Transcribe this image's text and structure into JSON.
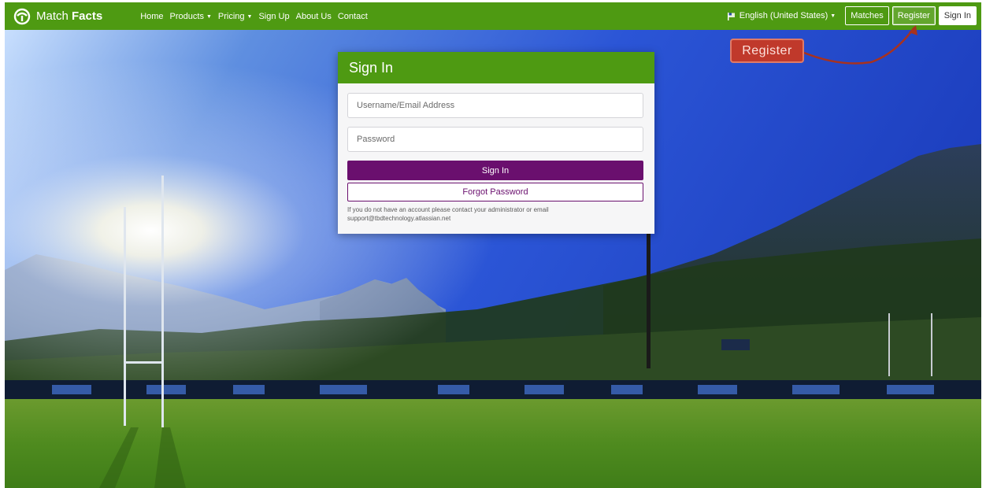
{
  "brand": {
    "name_light": "Match ",
    "name_bold": "Facts",
    "icon": "matchfacts-logo-icon"
  },
  "nav": {
    "links": [
      {
        "label": "Home",
        "dropdown": false
      },
      {
        "label": "Products",
        "dropdown": true
      },
      {
        "label": "Pricing",
        "dropdown": true
      },
      {
        "label": "Sign Up",
        "dropdown": false
      },
      {
        "label": "About Us",
        "dropdown": false
      },
      {
        "label": "Contact",
        "dropdown": false
      }
    ],
    "language": {
      "label": "English (United States)",
      "icon": "flag-icon"
    },
    "matches_label": "Matches",
    "register_label": "Register",
    "signin_label": "Sign In"
  },
  "annotation": {
    "callout_text": "Register",
    "color": "#c0392b"
  },
  "login": {
    "title": "Sign In",
    "username_placeholder": "Username/Email Address",
    "password_placeholder": "Password",
    "submit_label": "Sign In",
    "forgot_label": "Forgot Password",
    "help_text": "If you do not have an account please contact your administrator or email support@tbdtechnology.atlassian.net"
  },
  "colors": {
    "navbar": "#4e9a12",
    "primary": "#6a0f6e",
    "accent": "#c0392b"
  }
}
